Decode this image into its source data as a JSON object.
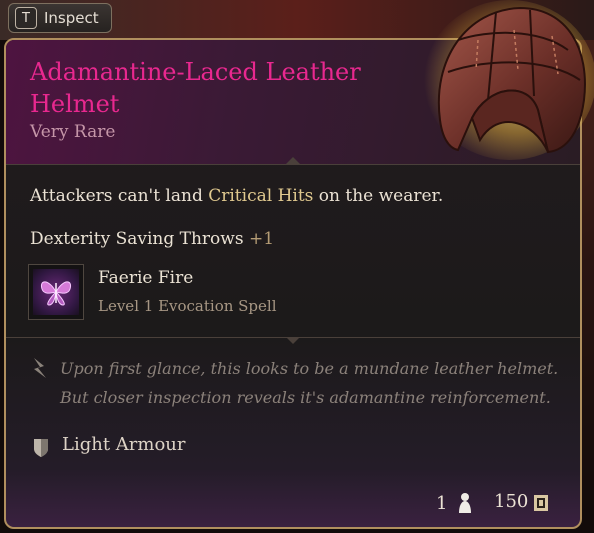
{
  "inspect": {
    "key": "T",
    "label": "Inspect"
  },
  "item": {
    "name": "Adamantine-Laced Leather Helmet",
    "rarity": "Very Rare",
    "rarity_color": "#e8288f"
  },
  "effects": {
    "crit_pre": "Attackers can't land ",
    "crit_highlight": "Critical Hits",
    "crit_post": " on the wearer.",
    "save_label": "Dexterity Saving Throws",
    "save_bonus": "+1"
  },
  "spell": {
    "icon": "butterfly-spell-icon",
    "name": "Faerie Fire",
    "level": "Level 1 Evocation Spell"
  },
  "flavor": {
    "icon": "quill-icon",
    "text": "Upon first glance, this looks to be a mundane leather helmet. But closer inspection reveals it's adamantine reinforcement."
  },
  "armour": {
    "icon": "shield-icon",
    "label": "Light Armour"
  },
  "footer": {
    "quantity": "1",
    "quantity_icon": "weight-icon",
    "value": "150",
    "value_icon": "gold-coin-icon"
  }
}
